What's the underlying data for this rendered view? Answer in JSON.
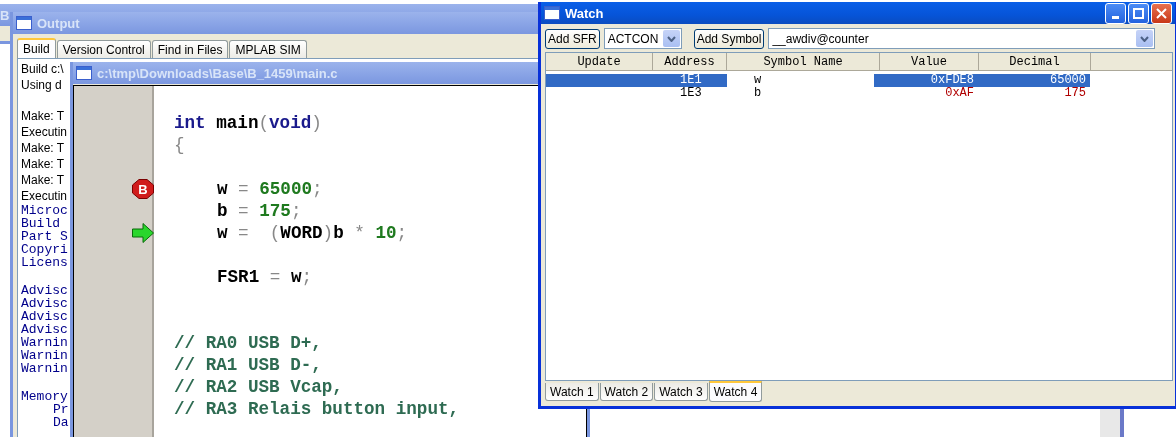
{
  "background_window": {
    "title": "B",
    "active": false
  },
  "output": {
    "title": "Output",
    "active": false,
    "tabs": [
      {
        "label": "Build",
        "selected": true
      },
      {
        "label": "Version Control",
        "selected": false
      },
      {
        "label": "Find in Files",
        "selected": false
      },
      {
        "label": "MPLAB SIM",
        "selected": false
      }
    ],
    "blocks": [
      [
        {
          "kind": "message",
          "text": "Build c:\\"
        },
        {
          "kind": "message",
          "text": "Using d"
        }
      ],
      [
        {
          "kind": "message",
          "text": "Make: T"
        },
        {
          "kind": "message",
          "text": "Executin"
        },
        {
          "kind": "message",
          "text": "Make: T"
        },
        {
          "kind": "message",
          "text": "Make: T"
        },
        {
          "kind": "message",
          "text": "Make: T"
        },
        {
          "kind": "message",
          "text": "Executin"
        },
        {
          "kind": "log",
          "text": "Microc"
        },
        {
          "kind": "log",
          "text": "Build"
        },
        {
          "kind": "log",
          "text": "Part S"
        },
        {
          "kind": "log",
          "text": "Copyri"
        },
        {
          "kind": "log",
          "text": "Licens"
        }
      ],
      [
        {
          "kind": "log",
          "text": "Advisc"
        },
        {
          "kind": "log",
          "text": "Advisc"
        },
        {
          "kind": "log",
          "text": "Advisc"
        },
        {
          "kind": "log",
          "text": "Advisc"
        },
        {
          "kind": "log",
          "text": "Warnin"
        },
        {
          "kind": "log",
          "text": "Warnin"
        },
        {
          "kind": "log",
          "text": "Warnin"
        }
      ],
      [
        {
          "kind": "log",
          "text": "Memory"
        },
        {
          "kind": "detail",
          "text": "Pr"
        },
        {
          "kind": "detail",
          "text": "Da"
        }
      ]
    ]
  },
  "editor": {
    "title": "c:\\tmp\\Downloads\\Base\\B_1459\\main.c",
    "active": false,
    "blocks": [
      [
        {
          "indented": false,
          "tokens": [
            {
              "kind": "keyword",
              "text": "int"
            },
            {
              "kind": "ident",
              "text": " main"
            },
            {
              "kind": "punct",
              "text": "("
            },
            {
              "kind": "keyword",
              "text": "void"
            },
            {
              "kind": "punct",
              "text": ")"
            }
          ]
        },
        {
          "indented": false,
          "tokens": [
            {
              "kind": "punct",
              "text": "{"
            }
          ]
        }
      ],
      [
        {
          "indented": true,
          "marker": {
            "kind": "breakpoint",
            "label": "B"
          },
          "tokens": [
            {
              "kind": "ident",
              "text": "w"
            },
            {
              "kind": "punct",
              "text": " = "
            },
            {
              "kind": "number",
              "text": "65000"
            },
            {
              "kind": "punct",
              "text": ";"
            }
          ]
        },
        {
          "indented": true,
          "tokens": [
            {
              "kind": "ident",
              "text": "b"
            },
            {
              "kind": "punct",
              "text": " = "
            },
            {
              "kind": "number",
              "text": "175"
            },
            {
              "kind": "punct",
              "text": ";"
            }
          ]
        },
        {
          "indented": true,
          "marker": {
            "kind": "arrow"
          },
          "tokens": [
            {
              "kind": "ident",
              "text": "w"
            },
            {
              "kind": "punct",
              "text": " =  ("
            },
            {
              "kind": "ident",
              "text": "WORD"
            },
            {
              "kind": "punct",
              "text": ")"
            },
            {
              "kind": "ident",
              "text": "b"
            },
            {
              "kind": "punct",
              "text": " * "
            },
            {
              "kind": "number",
              "text": "10"
            },
            {
              "kind": "punct",
              "text": ";"
            }
          ]
        }
      ],
      [
        {
          "indented": true,
          "tokens": [
            {
              "kind": "ident",
              "text": "FSR1"
            },
            {
              "kind": "punct",
              "text": " = "
            },
            {
              "kind": "ident",
              "text": "w"
            },
            {
              "kind": "punct",
              "text": ";"
            }
          ]
        }
      ],
      [
        {
          "indented": false,
          "tokens": [
            {
              "kind": "comment",
              "text": "// RA0 USB D+,"
            }
          ]
        },
        {
          "indented": false,
          "tokens": [
            {
              "kind": "comment",
              "text": "// RA1 USB D-,"
            }
          ]
        },
        {
          "indented": false,
          "tokens": [
            {
              "kind": "comment",
              "text": "// RA2 USB Vcap,"
            }
          ]
        },
        {
          "indented": false,
          "tokens": [
            {
              "kind": "comment",
              "text": "// RA3 Relais button input,"
            }
          ]
        }
      ]
    ]
  },
  "watch": {
    "title": "Watch",
    "active": true,
    "toolbar": {
      "add_sfr": "Add SFR",
      "sfr_select": "ACTCON",
      "add_symbol": "Add Symbol",
      "symbol_combo": "__awdiv@counter"
    },
    "columns": [
      "Update",
      "Address",
      "Symbol Name",
      "Value",
      "Decimal"
    ],
    "rows": [
      {
        "address": "1E1",
        "symbol": "w",
        "value": "0xFDE8",
        "decimal": "65000",
        "selected": true,
        "changed": false
      },
      {
        "address": "1E3",
        "symbol": "b",
        "value": "0xAF",
        "decimal": "175",
        "selected": false,
        "changed": true
      }
    ],
    "tabs": [
      {
        "label": "Watch 1",
        "selected": false
      },
      {
        "label": "Watch 2",
        "selected": false
      },
      {
        "label": "Watch 3",
        "selected": false
      },
      {
        "label": "Watch 4",
        "selected": true
      }
    ]
  }
}
